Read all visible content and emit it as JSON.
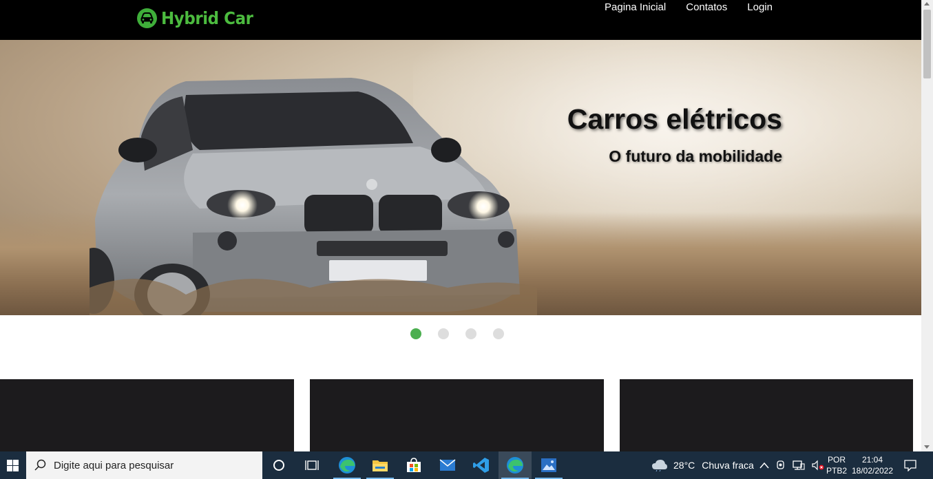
{
  "header": {
    "logo_text": "Hybrid Car",
    "nav": [
      {
        "label": "Pagina Inicial"
      },
      {
        "label": "Contatos"
      },
      {
        "label": "Login"
      }
    ]
  },
  "hero": {
    "title": "Carros elétricos",
    "subtitle": "O futuro da mobilidade",
    "slides_count": 4,
    "active_slide": 1
  },
  "taskbar": {
    "search_placeholder": "Digite aqui para pesquisar",
    "weather": {
      "temp": "28°C",
      "condition": "Chuva fraca"
    },
    "language": {
      "line1": "POR",
      "line2": "PTB2"
    },
    "clock": {
      "time": "21:04",
      "date": "18/02/2022"
    },
    "apps": [
      "cortana-icon",
      "task-view-icon",
      "edge-icon",
      "file-explorer-icon",
      "store-icon",
      "mail-icon",
      "vscode-icon",
      "edge-active-icon",
      "photos-icon"
    ]
  },
  "colors": {
    "brand_green": "#4cbb3f",
    "active_dot": "#4caf50",
    "taskbar": "#1b2d3f",
    "card_bg": "#1c1b1d"
  }
}
